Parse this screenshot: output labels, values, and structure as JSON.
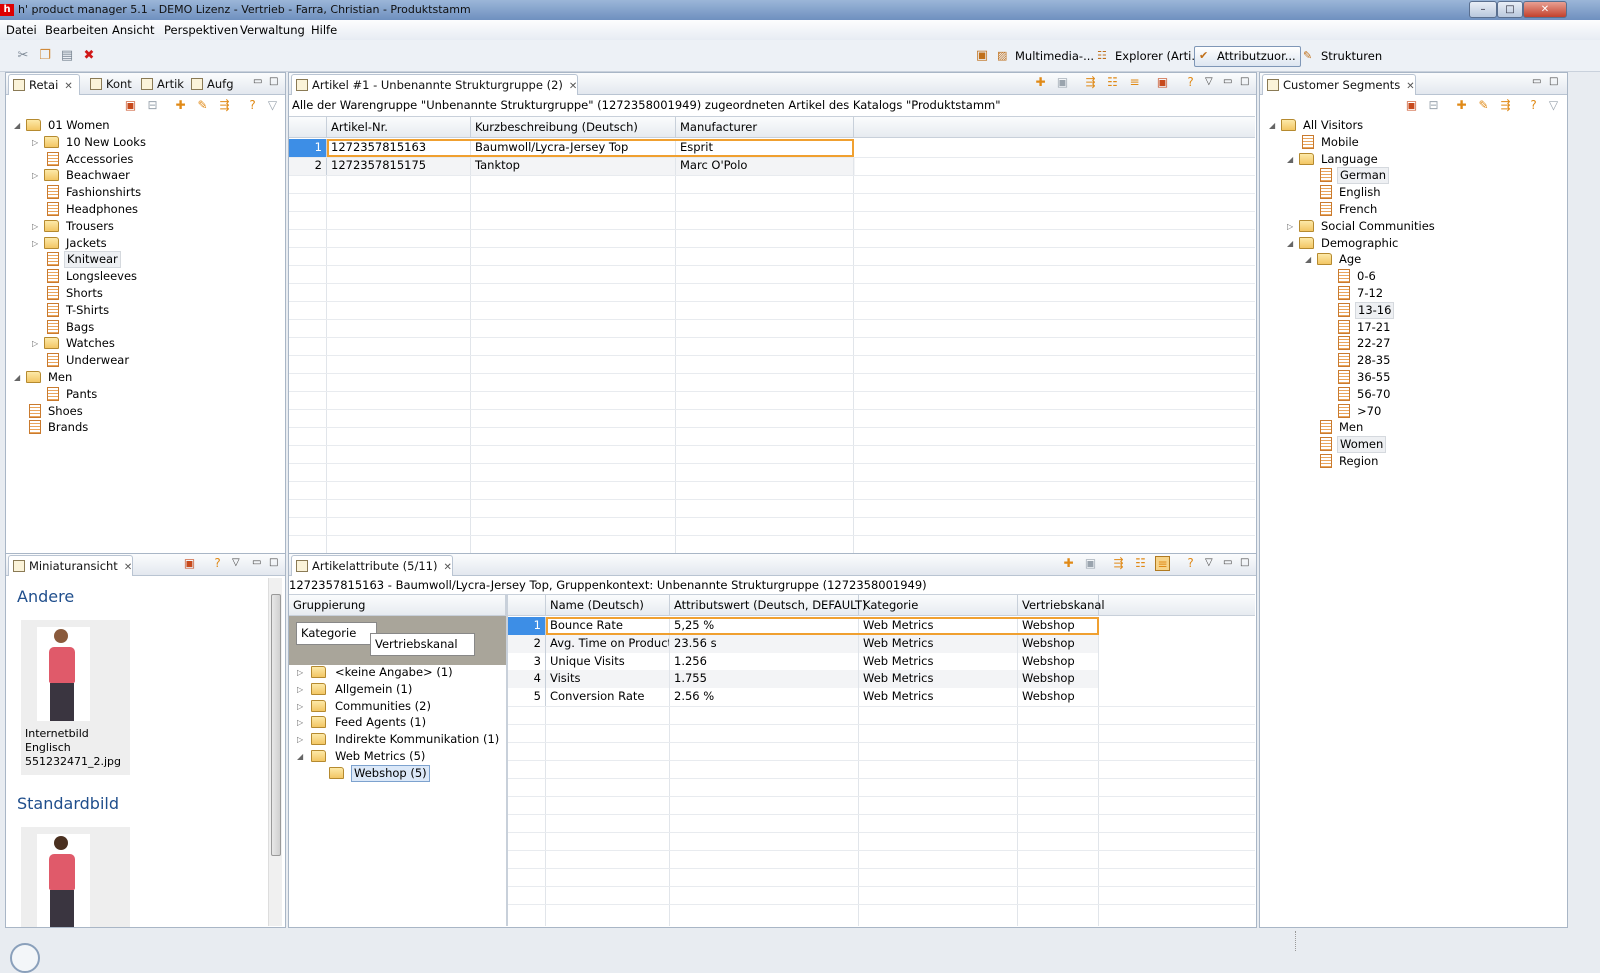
{
  "window": {
    "logo": "h",
    "title": "h' product manager 5.1 - DEMO Lizenz - Vertrieb - Farra, Christian - Produktstamm",
    "min": "–",
    "max": "□",
    "close": "✕"
  },
  "menu": [
    "Datei",
    "Bearbeiten",
    "Ansicht",
    "Perspektiven",
    "Verwaltung",
    "Hilfe"
  ],
  "perspectives": [
    {
      "label": "Multimedia-...",
      "icon": "image-icon"
    },
    {
      "label": "Explorer (Arti...",
      "icon": "explorer-icon"
    },
    {
      "label": "Attributzuor...",
      "icon": "attribute-icon"
    },
    {
      "label": "Strukturen",
      "icon": "structure-icon"
    }
  ],
  "left_panel": {
    "tabs": [
      "Retai",
      "Kont",
      "Artik",
      "Aufg"
    ],
    "tree": [
      {
        "label": "01 Women",
        "level": 0,
        "type": "folder-open",
        "arrow": "open"
      },
      {
        "label": "10 New Looks",
        "level": 1,
        "type": "folder",
        "arrow": "closed"
      },
      {
        "label": "Accessories",
        "level": 1,
        "type": "doc"
      },
      {
        "label": "Beachwaer",
        "level": 1,
        "type": "folder",
        "arrow": "closed"
      },
      {
        "label": "Fashionshirts",
        "level": 1,
        "type": "doc"
      },
      {
        "label": "Headphones",
        "level": 1,
        "type": "doc"
      },
      {
        "label": "Trousers",
        "level": 1,
        "type": "folder",
        "arrow": "closed"
      },
      {
        "label": "Jackets",
        "level": 1,
        "type": "folder",
        "arrow": "closed"
      },
      {
        "label": "Knitwear",
        "level": 1,
        "type": "doc",
        "selected": true
      },
      {
        "label": "Longsleeves",
        "level": 1,
        "type": "doc"
      },
      {
        "label": "Shorts",
        "level": 1,
        "type": "doc"
      },
      {
        "label": "T-Shirts",
        "level": 1,
        "type": "doc"
      },
      {
        "label": "Bags",
        "level": 1,
        "type": "doc"
      },
      {
        "label": "Watches",
        "level": 1,
        "type": "folder",
        "arrow": "closed"
      },
      {
        "label": "Underwear",
        "level": 1,
        "type": "doc"
      },
      {
        "label": "Men",
        "level": 0,
        "type": "folder-open",
        "arrow": "open"
      },
      {
        "label": "Pants",
        "level": 1,
        "type": "doc"
      },
      {
        "label": "Shoes",
        "level": 0,
        "type": "doc"
      },
      {
        "label": "Brands",
        "level": 0,
        "type": "doc"
      }
    ]
  },
  "articles_panel": {
    "tab": "Artikel #1 - Unbenannte Strukturgruppe (2)",
    "description": "Alle der Warengruppe \"Unbenannte Strukturgruppe\" (1272358001949) zugeordneten Artikel des Katalogs \"Produktstamm\"",
    "columns": [
      "Artikel-Nr.",
      "Kurzbeschreibung (Deutsch)",
      "Manufacturer"
    ],
    "rows": [
      {
        "n": "1",
        "cells": [
          "1272357815163",
          "Baumwoll/Lycra-Jersey Top",
          "Esprit"
        ]
      },
      {
        "n": "2",
        "cells": [
          "1272357815175",
          "Tanktop",
          "Marc O'Polo"
        ]
      }
    ]
  },
  "segments_panel": {
    "tab": "Customer Segments",
    "tree": [
      {
        "label": "All Visitors",
        "level": 0,
        "type": "folder-open",
        "arrow": "open"
      },
      {
        "label": "Mobile",
        "level": 1,
        "type": "doc"
      },
      {
        "label": "Language",
        "level": 1,
        "type": "folder-open",
        "arrow": "open"
      },
      {
        "label": "German",
        "level": 2,
        "type": "doc",
        "selected": true
      },
      {
        "label": "English",
        "level": 2,
        "type": "doc"
      },
      {
        "label": "French",
        "level": 2,
        "type": "doc"
      },
      {
        "label": "Social Communities",
        "level": 1,
        "type": "folder",
        "arrow": "closed"
      },
      {
        "label": "Demographic",
        "level": 1,
        "type": "folder-open",
        "arrow": "open"
      },
      {
        "label": "Age",
        "level": 2,
        "type": "folder-open",
        "arrow": "open"
      },
      {
        "label": "0-6",
        "level": 3,
        "type": "doc"
      },
      {
        "label": "7-12",
        "level": 3,
        "type": "doc"
      },
      {
        "label": "13-16",
        "level": 3,
        "type": "doc",
        "selected": true
      },
      {
        "label": "17-21",
        "level": 3,
        "type": "doc"
      },
      {
        "label": "22-27",
        "level": 3,
        "type": "doc"
      },
      {
        "label": "28-35",
        "level": 3,
        "type": "doc"
      },
      {
        "label": "36-55",
        "level": 3,
        "type": "doc"
      },
      {
        "label": "56-70",
        "level": 3,
        "type": "doc"
      },
      {
        "label": ">70",
        "level": 3,
        "type": "doc"
      },
      {
        "label": "Men",
        "level": 2,
        "type": "doc"
      },
      {
        "label": "Women",
        "level": 2,
        "type": "doc",
        "selected": true
      },
      {
        "label": "Region",
        "level": 2,
        "type": "doc"
      }
    ]
  },
  "thumbnail_panel": {
    "tab": "Miniaturansicht",
    "sections": [
      {
        "heading": "Andere",
        "caption": [
          "Internetbild",
          "Englisch",
          "551232471_2.jpg"
        ]
      },
      {
        "heading": "Standardbild",
        "caption": []
      }
    ]
  },
  "attributes_panel": {
    "tab": "Artikelattribute (5/11)",
    "context": "1272357815163 - Baumwoll/Lycra-Jersey Top, Gruppenkontext: Unbenannte Strukturgruppe (1272358001949)",
    "grouping_header": "Gruppierung",
    "group_chips": [
      "Kategorie",
      "Vertriebskanal"
    ],
    "groups": [
      {
        "label": "<keine Angabe> (1)",
        "level": 0,
        "arrow": "closed"
      },
      {
        "label": "Allgemein (1)",
        "level": 0,
        "arrow": "closed"
      },
      {
        "label": "Communities (2)",
        "level": 0,
        "arrow": "closed"
      },
      {
        "label": "Feed Agents (1)",
        "level": 0,
        "arrow": "closed"
      },
      {
        "label": "Indirekte Kommunikation (1)",
        "level": 0,
        "arrow": "closed"
      },
      {
        "label": "Web Metrics (5)",
        "level": 0,
        "arrow": "open"
      },
      {
        "label": "Webshop (5)",
        "level": 1,
        "arrow": "none",
        "selected": true
      }
    ],
    "columns": [
      "Name (Deutsch)",
      "Attributswert (Deutsch, DEFAULT)",
      "Kategorie",
      "Vertriebskanal"
    ],
    "rows": [
      {
        "n": "1",
        "cells": [
          "Bounce Rate",
          "5,25 %",
          "Web Metrics",
          "Webshop"
        ]
      },
      {
        "n": "2",
        "cells": [
          "Avg. Time on Product",
          "23.56 s",
          "Web Metrics",
          "Webshop"
        ]
      },
      {
        "n": "3",
        "cells": [
          "Unique Visits",
          "1.256",
          "Web Metrics",
          "Webshop"
        ]
      },
      {
        "n": "4",
        "cells": [
          "Visits",
          "1.755",
          "Web Metrics",
          "Webshop"
        ]
      },
      {
        "n": "5",
        "cells": [
          "Conversion Rate",
          "2.56 %",
          "Web Metrics",
          "Webshop"
        ]
      }
    ]
  },
  "colors": {
    "selection": "#3d8ee6",
    "focus_border": "#f0a030",
    "heading": "#1f4e8c",
    "accent": "#e08a17"
  }
}
